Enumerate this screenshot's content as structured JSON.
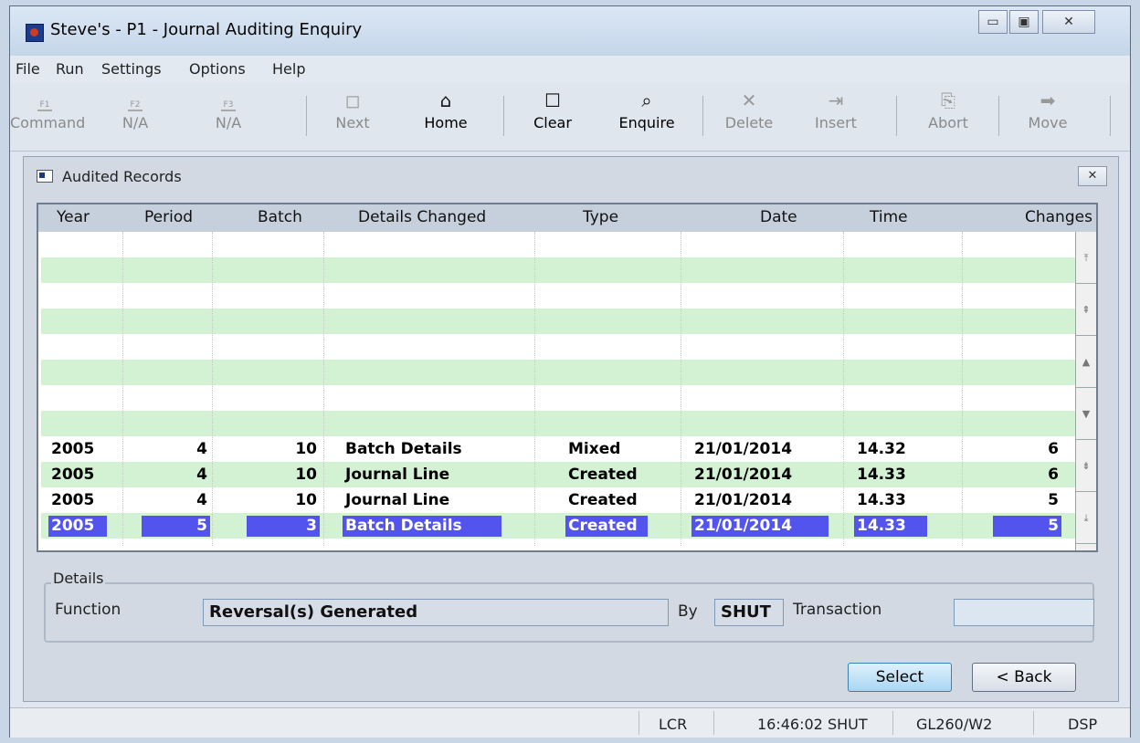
{
  "window": {
    "title": "Steve's - P1 - Journal Auditing Enquiry"
  },
  "window_controls": {
    "minimize": "▭",
    "maximize": "▣",
    "close": "✕"
  },
  "menu": [
    "File",
    "Run",
    "Settings",
    "Options",
    "Help"
  ],
  "toolbar": [
    {
      "key": "F1",
      "label": "Command",
      "icon": "command-icon",
      "enabled": false
    },
    {
      "key": "F2",
      "label": "N/A",
      "icon": "function-key-icon",
      "enabled": false
    },
    {
      "key": "F3",
      "label": "N/A",
      "icon": "function-key-icon",
      "enabled": false
    },
    {
      "label": "Next",
      "icon": "next-page-icon",
      "enabled": false
    },
    {
      "label": "Home",
      "icon": "home-icon",
      "enabled": true
    },
    {
      "label": "Clear",
      "icon": "clear-icon",
      "enabled": true
    },
    {
      "label": "Enquire",
      "icon": "magnifier-icon",
      "enabled": true
    },
    {
      "label": "Delete",
      "icon": "delete-x-icon",
      "enabled": false
    },
    {
      "label": "Insert",
      "icon": "insert-icon",
      "enabled": false
    },
    {
      "label": "Abort",
      "icon": "abort-icon",
      "enabled": false
    },
    {
      "label": "Move",
      "icon": "arrow-right-icon",
      "enabled": false
    }
  ],
  "panel": {
    "title": "Audited Records",
    "close_label": "✕"
  },
  "grid": {
    "columns": [
      "Year",
      "Period",
      "Batch",
      "Details Changed",
      "Type",
      "Date",
      "Time",
      "Changes"
    ],
    "rows": [
      [
        "2005",
        "4",
        "10",
        "Batch Details",
        "Mixed",
        "21/01/2014",
        "14.32",
        "6"
      ],
      [
        "2005",
        "4",
        "10",
        "Journal Line",
        "Created",
        "21/01/2014",
        "14.33",
        "6"
      ],
      [
        "2005",
        "4",
        "10",
        "Journal Line",
        "Created",
        "21/01/2014",
        "14.33",
        "5"
      ],
      [
        "2005",
        "5",
        "3",
        "Batch Details",
        "Created",
        "21/01/2014",
        "14.33",
        "5"
      ]
    ],
    "selected_row": 3
  },
  "details": {
    "group_label": "Details",
    "function_label": "Function",
    "function_value": "Reversal(s) Generated",
    "by_label": "By",
    "by_value": "SHUT",
    "transaction_label": "Transaction",
    "transaction_value": ""
  },
  "buttons": {
    "select": "Select",
    "back": "< Back"
  },
  "status": {
    "mode": "LCR",
    "time_user": "16:46:02  SHUT",
    "program": "GL260/W2",
    "state": "DSP"
  },
  "colors": {
    "row_green": "#d3f2d3",
    "selection": "#5353ee"
  }
}
